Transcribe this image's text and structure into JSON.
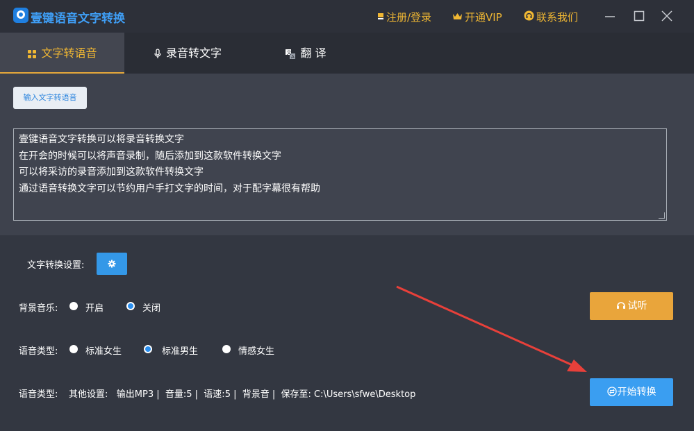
{
  "app": {
    "title": "壹键语音文字转换",
    "login_label": "注册/登录",
    "vip_label": "开通VIP",
    "contact_label": "联系我们"
  },
  "tabs": [
    {
      "label": "文字转语音",
      "icon": "text-to-speech-icon",
      "active": true
    },
    {
      "label": "录音转文字",
      "icon": "microphone-icon",
      "active": false
    },
    {
      "label": "翻    译",
      "icon": "translate-icon",
      "active": false
    }
  ],
  "editor": {
    "input_button_label": "输入文字转语音",
    "lines": [
      "壹键语音文字转换可以将录音转换文字",
      "在开会的时候可以将声音录制，随后添加到这款软件转换文字",
      "可以将采访的录音添加到这款软件转换文字",
      "通过语音转换文字可以节约用户手打文字的时间，对于配字幕很有帮助"
    ]
  },
  "settings": {
    "conversion_label": "文字转换设置:",
    "bg_music_label": "背景音乐:",
    "bg_music_options": [
      {
        "label": "开启",
        "selected": false
      },
      {
        "label": "关闭",
        "selected": true
      }
    ],
    "voice_type_label": "语音类型:",
    "voice_options": [
      {
        "label": "标准女生",
        "selected": false
      },
      {
        "label": "标准男生",
        "selected": true
      },
      {
        "label": "情感女生",
        "selected": false
      }
    ],
    "summary_label": "语音类型:",
    "summary_text": "其他设置:   输出MP3 |  音量:5 |  语速:5 |  背景音 |  保存至: C:\\Users\\sfwe\\Desktop"
  },
  "buttons": {
    "audition_label": "试听",
    "start_label": "开始转换"
  },
  "colors": {
    "accent_yellow": "#f0b733",
    "accent_blue": "#3a9ef1",
    "audition_orange": "#e9a53b",
    "arrow_red": "#e8403a"
  }
}
